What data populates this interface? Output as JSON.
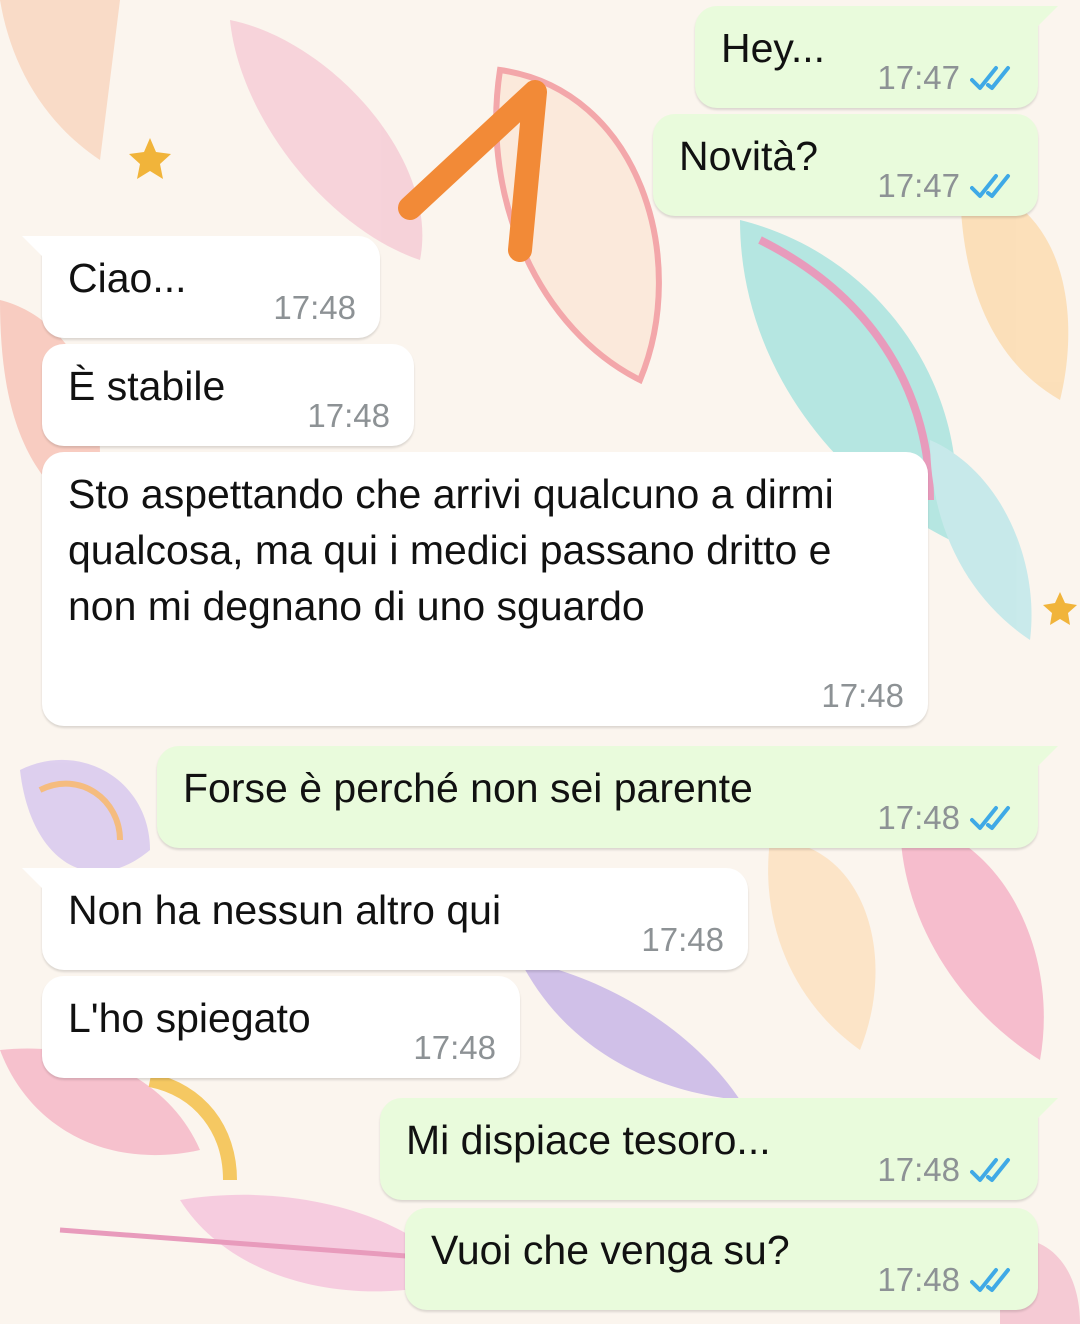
{
  "theme": {
    "incoming_bg": "#ffffff",
    "outgoing_bg": "#e9fbdc",
    "read_tick_color": "#3fa9e6",
    "annotation_arrow_color": "#f28a37"
  },
  "messages": [
    {
      "direction": "out",
      "text": "Hey...",
      "time": "17:47",
      "status": "read"
    },
    {
      "direction": "out",
      "text": "Novità?",
      "time": "17:47",
      "status": "read"
    },
    {
      "direction": "in",
      "text": "Ciao...",
      "time": "17:48"
    },
    {
      "direction": "in",
      "text": "È stabile",
      "time": "17:48"
    },
    {
      "direction": "in",
      "text": "Sto aspettando che arrivi qualcuno a dirmi qualcosa, ma qui i medici passano dritto e non mi degnano di uno sguardo",
      "time": "17:48"
    },
    {
      "direction": "out",
      "text": "Forse è perché non sei parente",
      "time": "17:48",
      "status": "read"
    },
    {
      "direction": "in",
      "text": "Non ha nessun altro qui",
      "time": "17:48"
    },
    {
      "direction": "in",
      "text": "L'ho spiegato",
      "time": "17:48"
    },
    {
      "direction": "out",
      "text": "Mi dispiace tesoro...",
      "time": "17:48",
      "status": "read"
    },
    {
      "direction": "out",
      "text": "Vuoi che venga su?",
      "time": "17:48",
      "status": "read"
    }
  ],
  "icons": {
    "read_receipt": "double-check-icon",
    "annotation": "upward-arrow-icon"
  }
}
